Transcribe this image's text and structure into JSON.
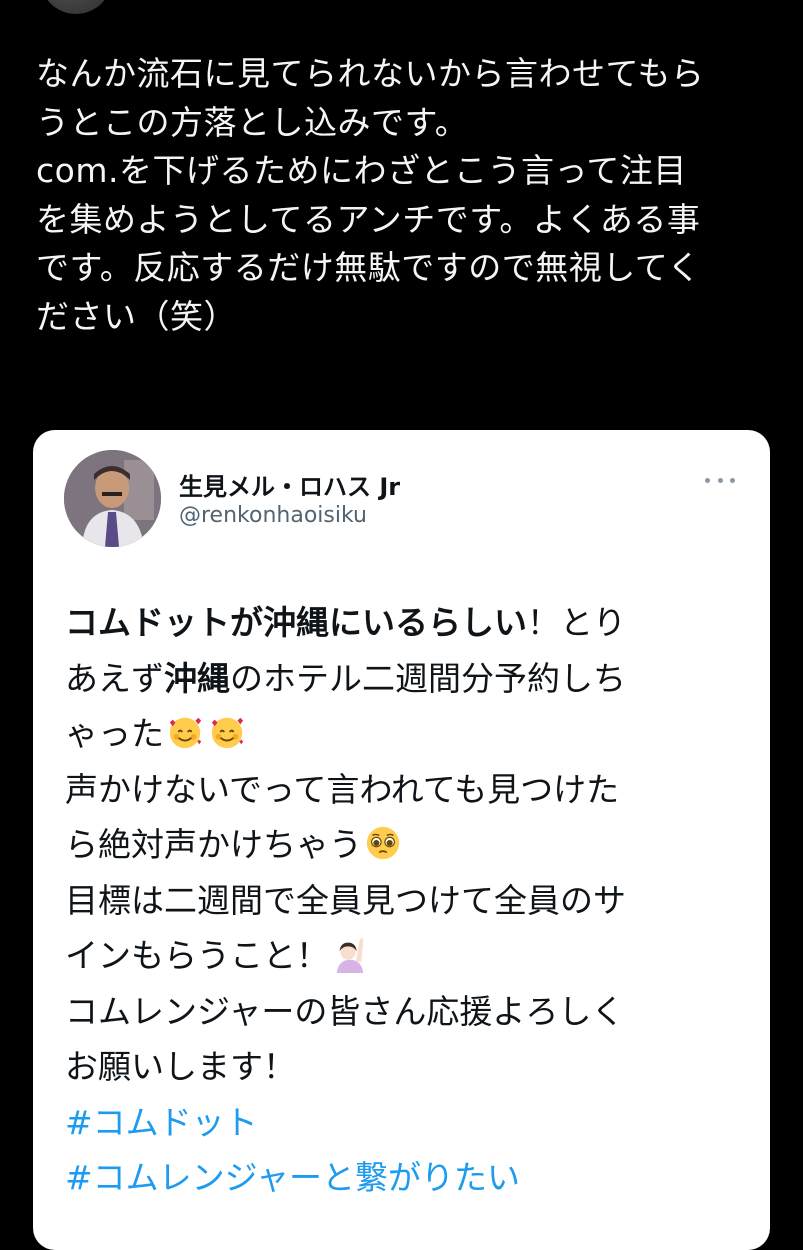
{
  "reply": {
    "lines": [
      "なんか流石に見てられないから言わせてもら",
      "うとこの方落とし込みです。",
      "com.を下げるためにわざとこう言って注目",
      "を集めようとしてるアンチです。よくある事",
      "です。反応するだけ無駄ですので無視してく",
      "ださい（笑）"
    ]
  },
  "quoted_tweet": {
    "display_name": "生見メル・ロハス Jr",
    "handle": "@renkonhaoisiku",
    "more_icon": "more-horizontal-icon",
    "body": {
      "l1_bold": "コムドットが沖縄にいるらしい",
      "l1_rest": "！とり",
      "l2_a": "あえず",
      "l2_bold": "沖縄",
      "l2_b": "のホテル二週間分予約しち",
      "l3": "ゃった",
      "l3_emoji": "smiling-face-with-hearts-emoji",
      "l4": "声かけないでって言われても見つけた",
      "l5": "ら絶対声かけちゃう",
      "l5_emoji": "pleading-face-emoji",
      "l6": "目標は二週間で全員見つけて全員のサ",
      "l7": "インもらうこと！",
      "l7_emoji": "person-raising-hand-emoji",
      "l8": "コムレンジャーの皆さん応援よろしく",
      "l9": "お願いします！",
      "hashtag1": "#コムドット",
      "hashtag2": "#コムレンジャーと繋がりたい"
    }
  },
  "colors": {
    "background": "#000000",
    "card_background": "#ffffff",
    "hashtag": "#1d9bf0",
    "handle": "#536471"
  }
}
